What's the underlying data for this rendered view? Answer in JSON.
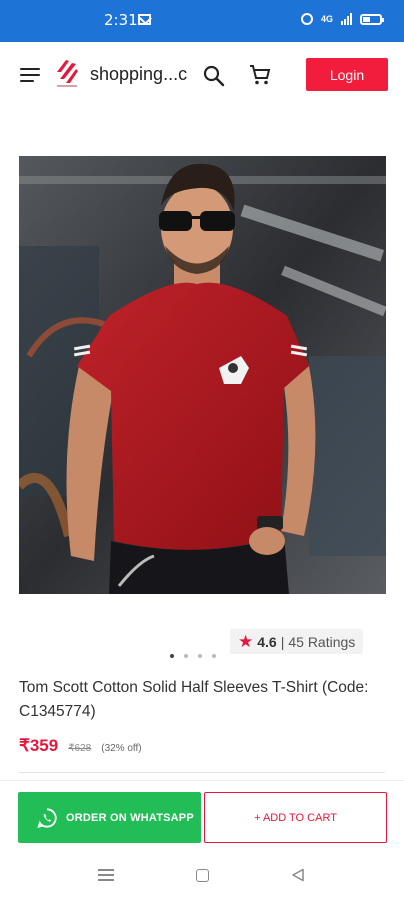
{
  "status_bar": {
    "time": "2:31",
    "icons": [
      "gmail-icon",
      "alarm-icon",
      "volte-icon",
      "signal-icon",
      "battery-icon"
    ],
    "network_label": "4G"
  },
  "header": {
    "brand": "shopping...c",
    "login_label": "Login",
    "icons": {
      "menu": "hamburger-icon",
      "search": "search-icon",
      "cart": "cart-icon"
    }
  },
  "product": {
    "image_alt": "product-photo",
    "rating_value": "4.6",
    "rating_separator": "|",
    "rating_count": "45 Ratings",
    "title": "Tom Scott Cotton Solid Half Sleeves T-Shirt (Code: C1345774)",
    "price": "₹359",
    "mrp": "₹628",
    "discount": "(32% off)",
    "carousel_pages": 4,
    "carousel_active": 0
  },
  "actions": {
    "whatsapp_label": "ORDER ON WHATSAPP",
    "add_to_cart_label": "+ ADD TO CART"
  },
  "colors": {
    "status_bar": "#1e73d6",
    "accent_red": "#f21d3c",
    "whatsapp_green": "#22bd57",
    "tshirt_red": "#b0161c"
  }
}
